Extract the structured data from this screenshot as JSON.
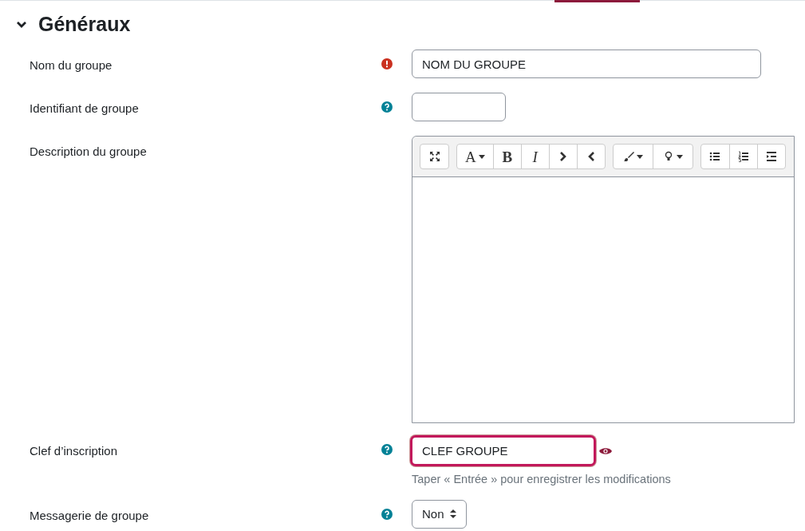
{
  "section": {
    "title": "Généraux",
    "expanded": true
  },
  "fields": [
    {
      "kind": "text",
      "label": "Nom du groupe",
      "required": true,
      "value": "NOM DU GROUPE"
    },
    {
      "kind": "short-text",
      "label": "Identifiant de groupe",
      "required": false
    },
    {
      "kind": "editor",
      "label": "Description du groupe",
      "toolbar": [
        [
          {
            "kind": "expand"
          }
        ],
        [
          {
            "kind": "menu",
            "label": "A"
          },
          {
            "kind": "bold",
            "label": "B"
          },
          {
            "kind": "italic",
            "label": "I"
          },
          {
            "kind": "chevron-right"
          },
          {
            "kind": "chevron-left"
          }
        ],
        [
          {
            "kind": "brush"
          },
          {
            "kind": "bulb"
          }
        ],
        [
          {
            "kind": "bullets"
          },
          {
            "kind": "numbers"
          },
          {
            "kind": "indent"
          }
        ]
      ]
    },
    {
      "kind": "password",
      "label": "Clef d’inscription",
      "required": false,
      "value": "CLEF GROUPE",
      "focused": true,
      "hint": "Taper « Entrée » pour enregistrer les modifications"
    },
    {
      "kind": "select",
      "label": "Messagerie de groupe",
      "required": false,
      "value": "Non"
    }
  ]
}
